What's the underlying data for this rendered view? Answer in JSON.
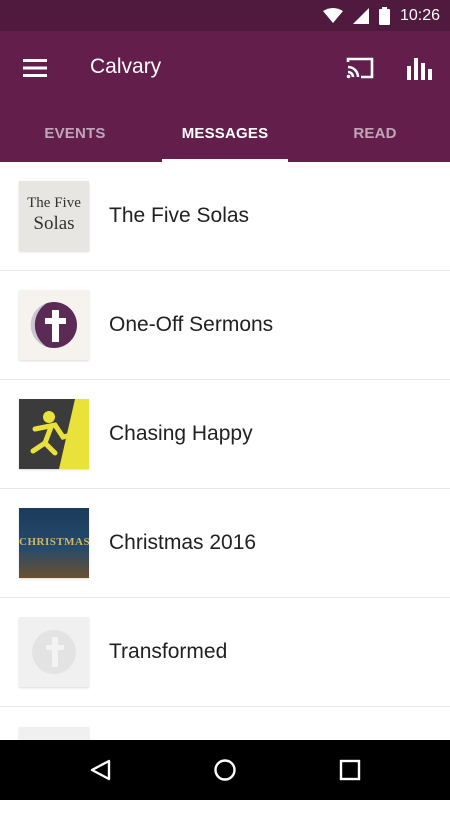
{
  "status_bar": {
    "time": "10:26",
    "icons": [
      "wifi-icon",
      "cellular-signal-icon",
      "battery-icon"
    ]
  },
  "app_bar": {
    "title": "Calvary",
    "icons": [
      "menu-icon",
      "cast-icon",
      "bar-chart-icon"
    ]
  },
  "colors": {
    "status_bar": "#4f1a3d",
    "app_bar": "#631e4c",
    "nav_bar": "#000000"
  },
  "tabs": [
    {
      "label": "EVENTS",
      "active": false
    },
    {
      "label": "MESSAGES",
      "active": true
    },
    {
      "label": "READ",
      "active": false
    }
  ],
  "messages": [
    {
      "title": "The Five Solas",
      "thumb_line1": "The Five",
      "thumb_line2": "Solas"
    },
    {
      "title": "One-Off Sermons"
    },
    {
      "title": "Chasing Happy"
    },
    {
      "title": "Christmas 2016",
      "thumb_text": "CHRISTMAS"
    },
    {
      "title": "Transformed"
    }
  ],
  "nav_bar": {
    "icons": [
      "back-icon",
      "home-icon",
      "recents-icon"
    ]
  }
}
